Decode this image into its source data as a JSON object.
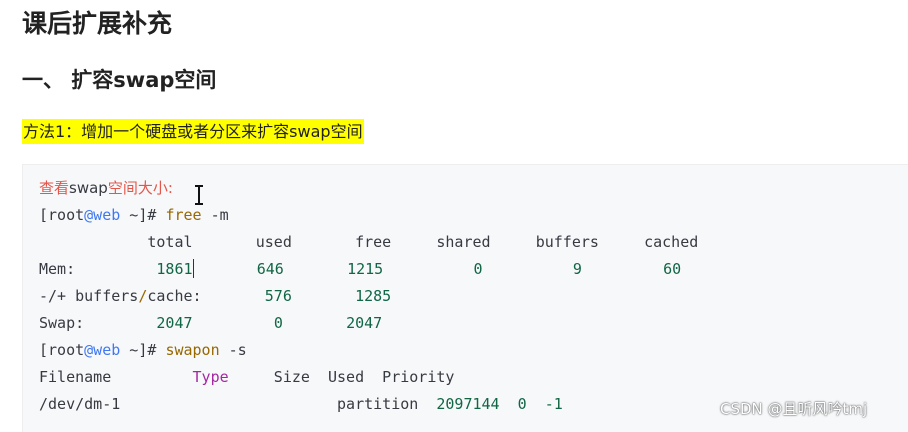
{
  "heading_main": "课后扩展补充",
  "heading_section": "一、 扩容swap空间",
  "method_note": "方法1：增加一个硬盘或者分区来扩容swap空间",
  "code": {
    "comment": {
      "part1": "查看",
      "part2": "swap",
      "part3": "空间大小:"
    },
    "prompt1": {
      "root": "[root",
      "at": "@web",
      "rest": " ~]# ",
      "cmd": "free",
      "flag": " -m"
    },
    "free_header": [
      "total",
      "used",
      "free",
      "shared",
      "buffers",
      "cached"
    ],
    "mem_row": {
      "label": "Mem:",
      "values": [
        "1861",
        "646",
        "1215",
        "0",
        "9",
        "60"
      ]
    },
    "buffers_row": {
      "label1": "-/+ buffers",
      "slash": "/",
      "label2": "cache:",
      "values": [
        "576",
        "1285"
      ]
    },
    "swap_row": {
      "label": "Swap:",
      "values": [
        "2047",
        "0",
        "2047"
      ]
    },
    "prompt2": {
      "root": "[root",
      "at": "@web",
      "rest": " ~]# ",
      "cmd": "swapon",
      "flag": " -s"
    },
    "swapon_header": {
      "filename": "Filename",
      "type": "Type",
      "rest": "     Size  Used  Priority"
    },
    "swapon_row": {
      "device": "/dev/dm-1",
      "type": "partition",
      "size": "2097144",
      "used": "0",
      "priority": "-1"
    }
  },
  "watermark": "CSDN @且听风吟tmj",
  "colors": {
    "highlight": "#ffff00",
    "code_background": "#f6f8fa",
    "comment": "#e45649",
    "keyword": "#986801",
    "number": "#116644",
    "at_host": "#4078f2"
  }
}
